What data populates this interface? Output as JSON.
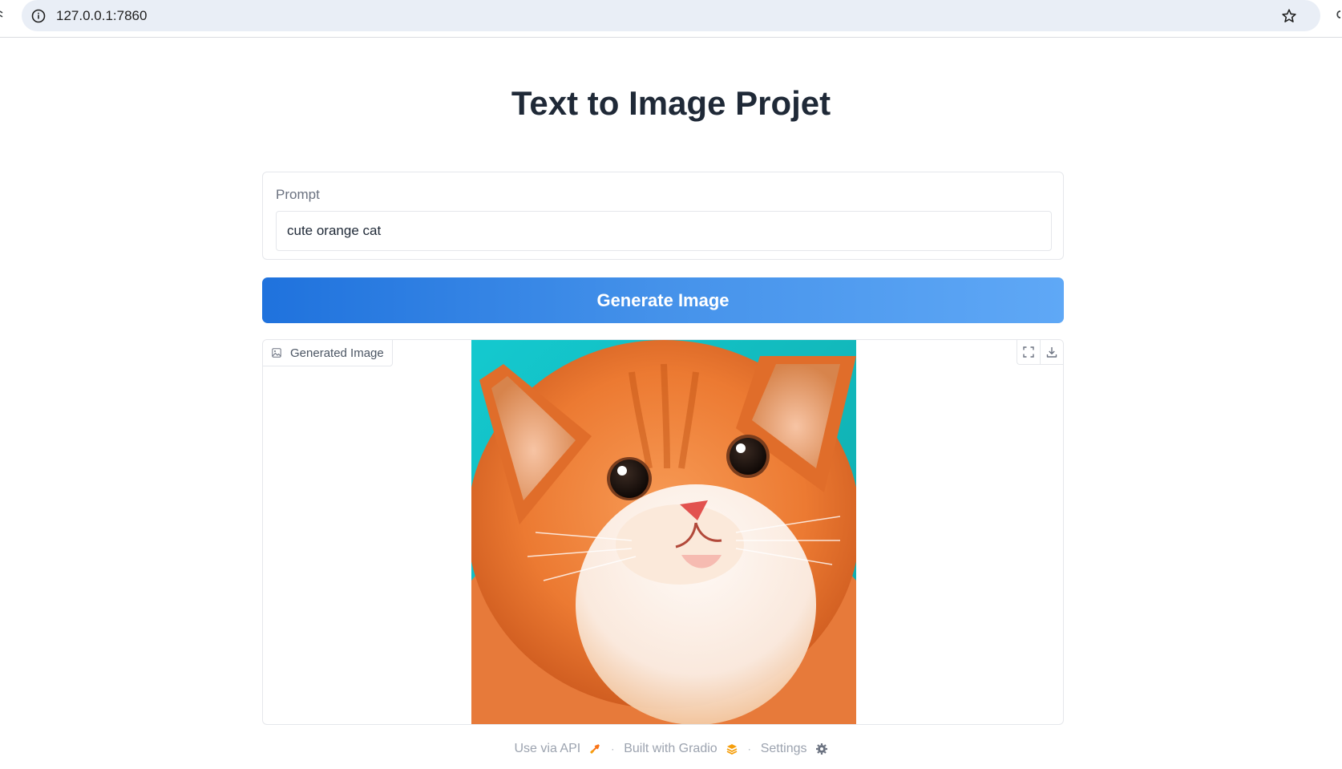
{
  "browser": {
    "url": "127.0.0.1:7860"
  },
  "app": {
    "title": "Text to Image Projet",
    "prompt": {
      "label": "Prompt",
      "value": "cute orange cat"
    },
    "generate_button_label": "Generate Image",
    "output": {
      "label": "Generated Image",
      "image_subject": "orange kitten on teal background"
    }
  },
  "footer": {
    "api_link": "Use via API",
    "built_with": "Built with Gradio",
    "settings": "Settings"
  },
  "colors": {
    "button_gradient_start": "#1f72dd",
    "button_gradient_end": "#5fa8f6",
    "gradio_logo": "#f59e0b"
  }
}
